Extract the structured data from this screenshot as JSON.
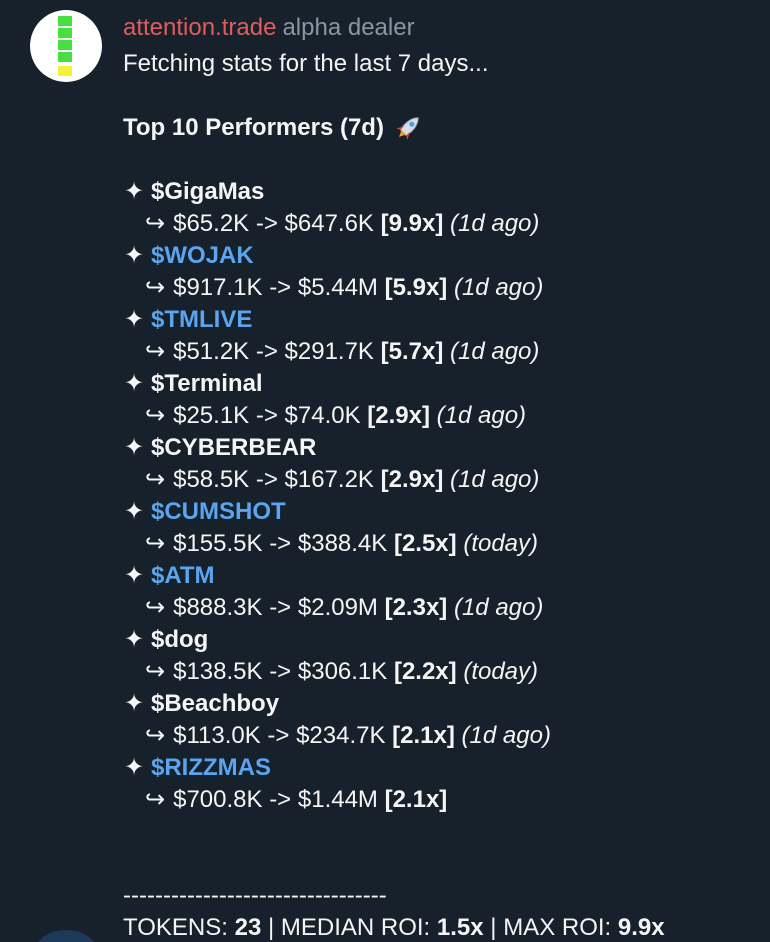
{
  "message": {
    "sender": "attention.trade",
    "role": "alpha dealer",
    "intro": "Fetching stats for the last 7 days...",
    "title": "Top 10 Performers (7d)",
    "title_icon": "rocket-icon",
    "entries": [
      {
        "name": "$GigaMas",
        "link": false,
        "detail": "$65.2K -> $647.6K",
        "mult": "[9.9x]",
        "age": "(1d ago)"
      },
      {
        "name": "$WOJAK",
        "link": true,
        "detail": "$917.1K -> $5.44M",
        "mult": "[5.9x]",
        "age": "(1d ago)"
      },
      {
        "name": "$TMLIVE",
        "link": true,
        "detail": "$51.2K -> $291.7K",
        "mult": "[5.7x]",
        "age": "(1d ago)"
      },
      {
        "name": "$Terminal",
        "link": false,
        "detail": "$25.1K -> $74.0K",
        "mult": "[2.9x]",
        "age": "(1d ago)"
      },
      {
        "name": "$CYBERBEAR",
        "link": false,
        "detail": "$58.5K -> $167.2K",
        "mult": "[2.9x]",
        "age": "(1d ago)"
      },
      {
        "name": "$CUMSHOT",
        "link": true,
        "detail": "$155.5K -> $388.4K",
        "mult": "[2.5x]",
        "age": "(today)"
      },
      {
        "name": "$ATM",
        "link": true,
        "detail": "$888.3K -> $2.09M",
        "mult": "[2.3x]",
        "age": "(1d ago)"
      },
      {
        "name": "$dog",
        "link": false,
        "detail": "$138.5K -> $306.1K",
        "mult": "[2.2x]",
        "age": "(today)"
      },
      {
        "name": "$Beachboy",
        "link": false,
        "detail": "$113.0K -> $234.7K",
        "mult": "[2.1x]",
        "age": "(1d ago)"
      },
      {
        "name": "$RIZZMAS",
        "link": true,
        "detail": "$700.8K -> $1.44M",
        "mult": "[2.1x]",
        "age": ""
      }
    ],
    "divider": "---------------------------------",
    "summary": {
      "tokens_label": "TOKENS:",
      "tokens_value": "23",
      "sep": "|",
      "median_label": "MEDIAN ROI:",
      "median_value": "1.5x",
      "max_label": "MAX ROI:",
      "max_value": "9.9x"
    }
  },
  "colors": {
    "background": "#17212b",
    "sender": "#e05d5d",
    "role": "#8b96a3",
    "link": "#5ba4f0",
    "text": "#f5f5f5"
  },
  "icons": {
    "star": "sparkle-icon",
    "arrow": "return-arrow-icon"
  }
}
